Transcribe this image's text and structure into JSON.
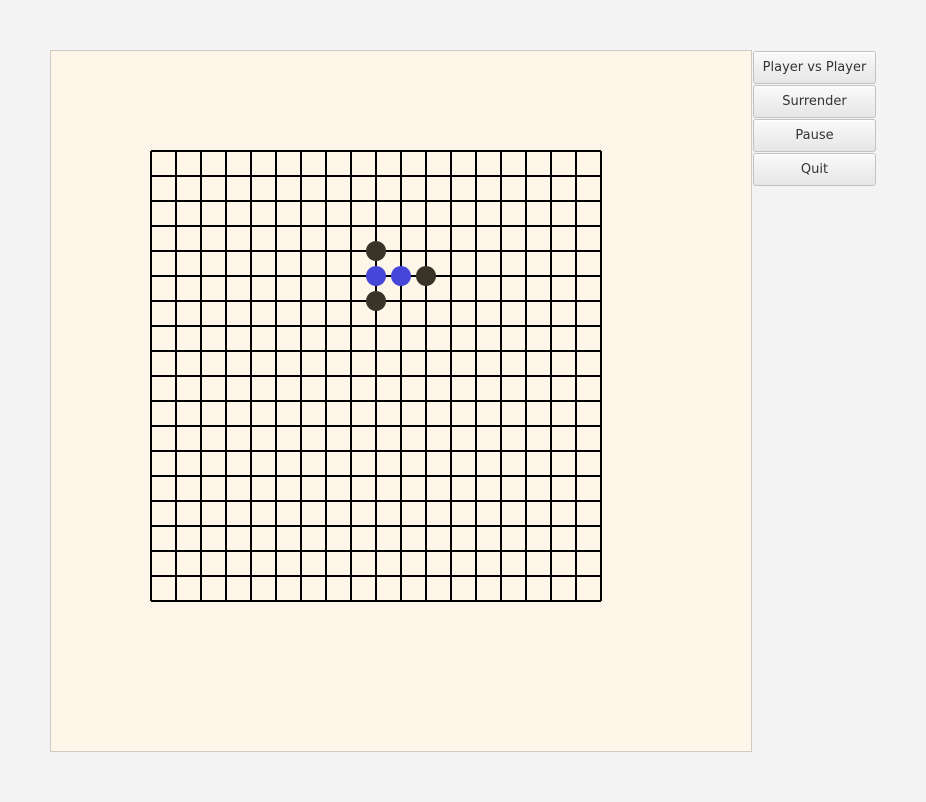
{
  "controls": {
    "mode_label": "Player vs Player",
    "surrender_label": "Surrender",
    "pause_label": "Pause",
    "quit_label": "Quit"
  },
  "board": {
    "size": 19,
    "colors": {
      "background": "#fef6e8",
      "grid_line": "#000000",
      "black_stone": "#3a3428",
      "blue_stone": "#4646d8"
    },
    "stones": [
      {
        "col": 9,
        "row": 4,
        "color": "black"
      },
      {
        "col": 9,
        "row": 5,
        "color": "blue"
      },
      {
        "col": 10,
        "row": 5,
        "color": "blue"
      },
      {
        "col": 11,
        "row": 5,
        "color": "black"
      },
      {
        "col": 9,
        "row": 6,
        "color": "black"
      }
    ]
  }
}
